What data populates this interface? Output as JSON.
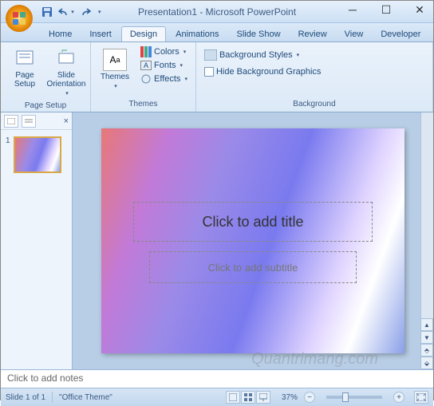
{
  "title": "Presentation1 - Microsoft PowerPoint",
  "tabs": [
    "Home",
    "Insert",
    "Design",
    "Animations",
    "Slide Show",
    "Review",
    "View",
    "Developer"
  ],
  "active_tab": "Design",
  "ribbon": {
    "page_setup": {
      "label": "Page Setup",
      "page_setup_btn": "Page\nSetup",
      "orientation_btn": "Slide\nOrientation"
    },
    "themes": {
      "label": "Themes",
      "themes_btn": "Themes",
      "colors": "Colors",
      "fonts": "Fonts",
      "effects": "Effects"
    },
    "background": {
      "label": "Background",
      "styles": "Background Styles",
      "hide": "Hide Background Graphics"
    }
  },
  "slide": {
    "title_placeholder": "Click to add title",
    "subtitle_placeholder": "Click to add subtitle"
  },
  "thumbnails": {
    "slide_num": "1"
  },
  "notes": {
    "placeholder": "Click to add notes"
  },
  "status": {
    "slide_info": "Slide 1 of 1",
    "theme": "\"Office Theme\"",
    "zoom": "37%"
  },
  "watermark": "Quantrimang.com"
}
